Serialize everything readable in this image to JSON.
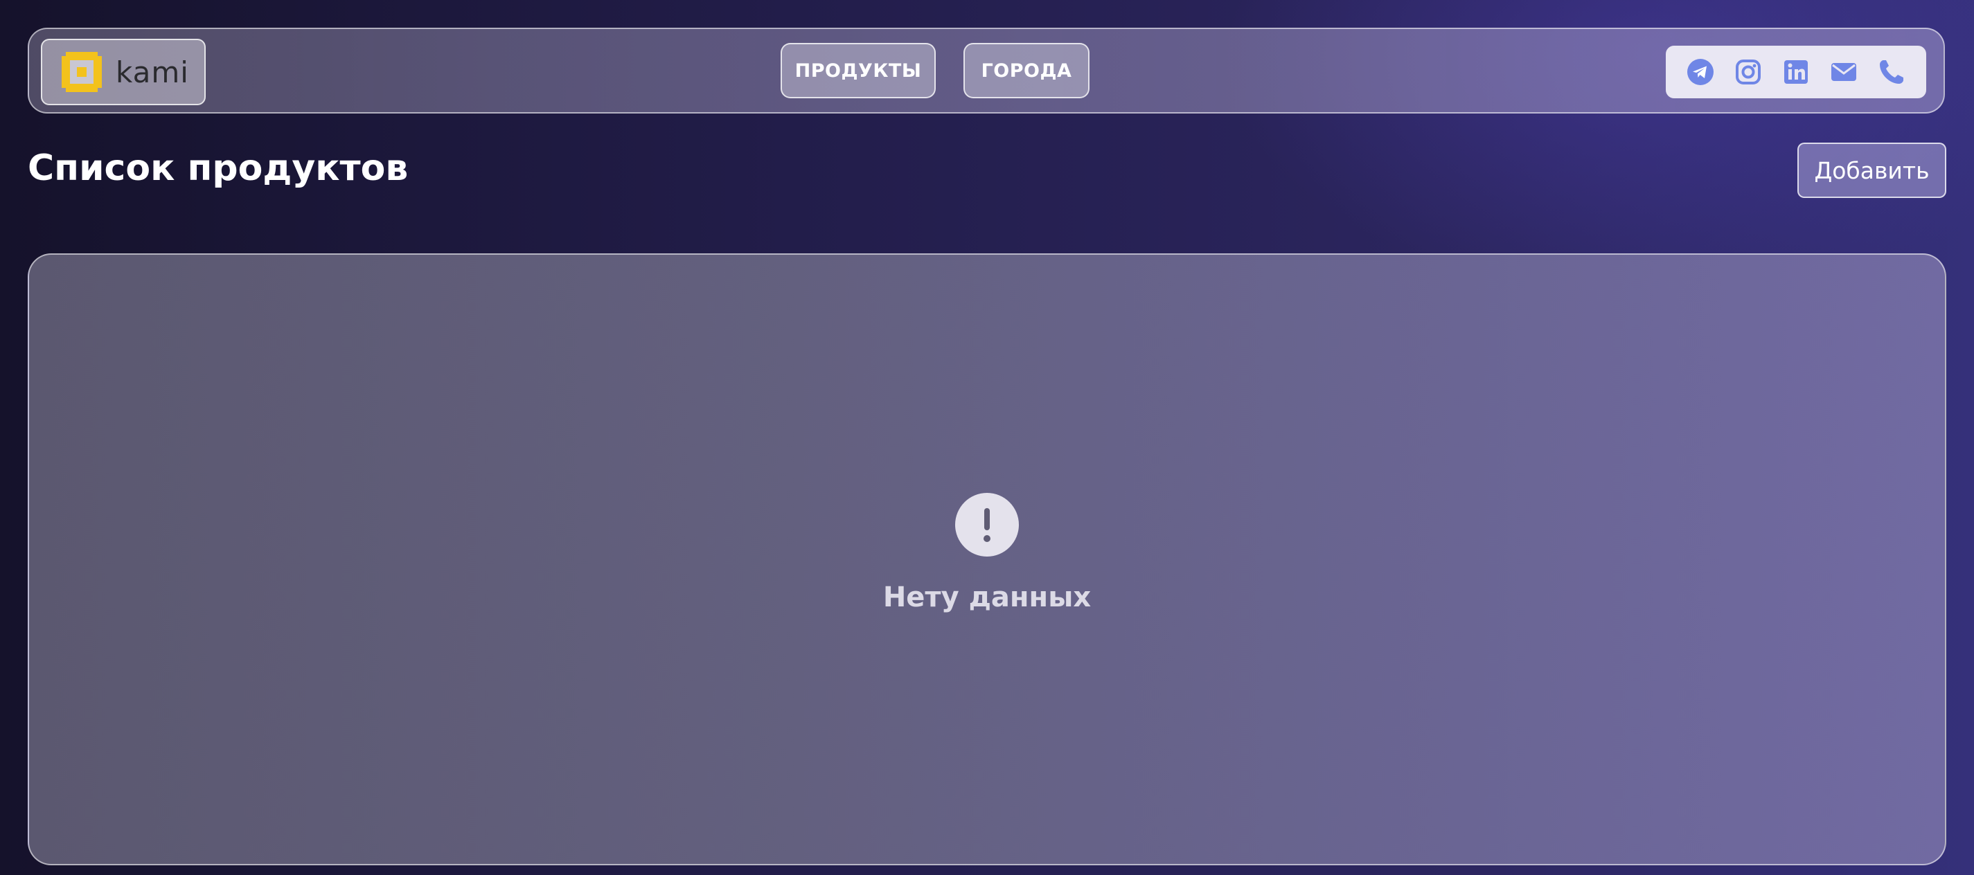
{
  "navbar": {
    "logo": {
      "text": "kami",
      "icon": "kami-logo-mark",
      "accent_color": "#f3c21c"
    },
    "nav_items": [
      {
        "label": "ПРОДУКТЫ"
      },
      {
        "label": "ГОРОДА"
      }
    ],
    "social_links": [
      {
        "icon": "telegram-icon"
      },
      {
        "icon": "instagram-icon"
      },
      {
        "icon": "linkedin-icon"
      },
      {
        "icon": "email-icon"
      },
      {
        "icon": "phone-icon"
      }
    ],
    "social_icon_color": "#6f86e6"
  },
  "header": {
    "title": "Список продуктов",
    "add_label": "Добавить"
  },
  "content": {
    "empty_state": {
      "icon": "exclamation-icon",
      "message": "Нету данных"
    }
  }
}
